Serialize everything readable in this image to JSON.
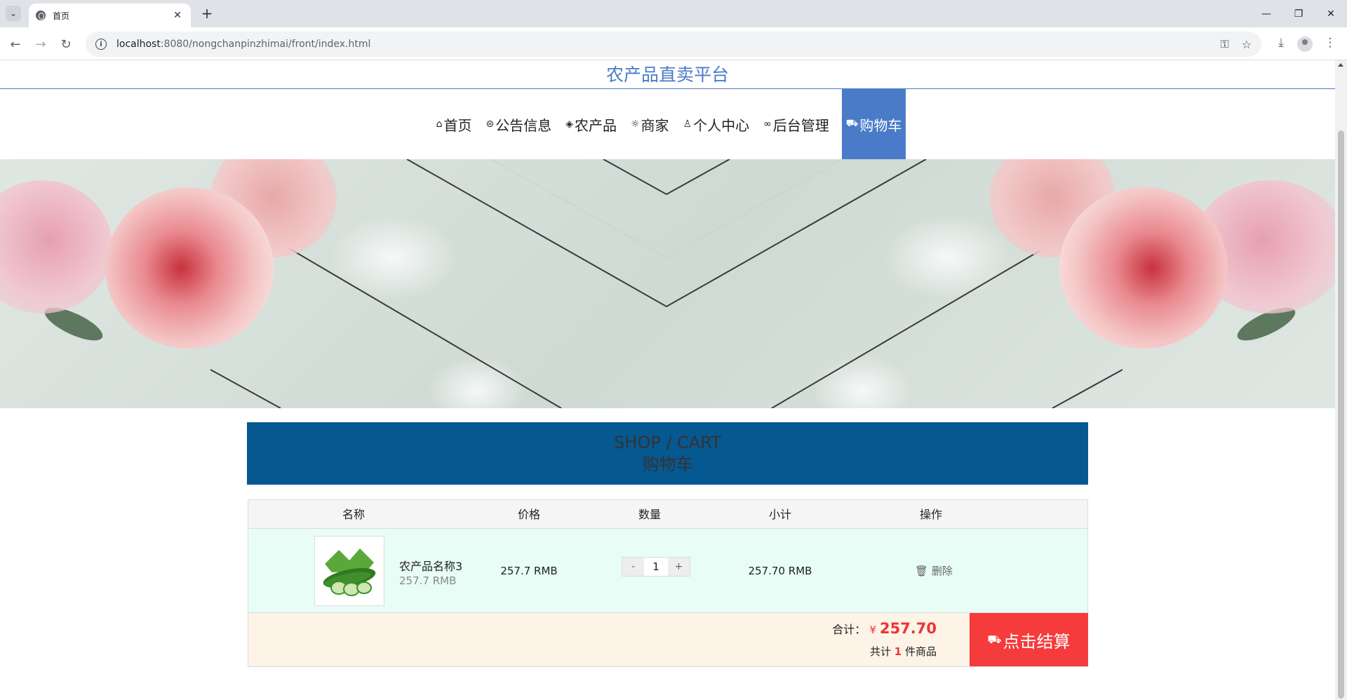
{
  "browser": {
    "tab_title": "首页",
    "url_host": "localhost",
    "url_rest": ":8080/nongchanpinzhimai/front/index.html"
  },
  "site": {
    "title": "农产品直卖平台"
  },
  "nav": [
    {
      "icon": "⌂",
      "label": "首页"
    },
    {
      "icon": "⊜",
      "label": "公告信息"
    },
    {
      "icon": "◈",
      "label": "农产品"
    },
    {
      "icon": "☼",
      "label": "商家"
    },
    {
      "icon": "♙",
      "label": "个人中心"
    },
    {
      "icon": "∞",
      "label": "后台管理"
    },
    {
      "icon": "⛟",
      "label": "购物车",
      "active": true
    }
  ],
  "cart_section": {
    "title_en": "SHOP / CART",
    "title_cn": "购物车"
  },
  "table": {
    "headers": [
      "名称",
      "价格",
      "数量",
      "小计",
      "操作"
    ],
    "rows": [
      {
        "name": "农产品名称3",
        "unit_price_sub": "257.7 RMB",
        "price": "257.7 RMB",
        "quantity": "1",
        "subtotal": "257.70 RMB",
        "action": "删除"
      }
    ],
    "qty_minus": "-",
    "qty_plus": "+"
  },
  "footer": {
    "total_label": "合计：",
    "currency": "¥",
    "total_amount": "257.70",
    "count_prefix": "共计",
    "count": "1",
    "count_suffix": "件商品",
    "checkout_label": "点击结算"
  },
  "colors": {
    "brand": "#4a7bc9",
    "cart_header": "#065891",
    "checkout": "#f53b3b"
  }
}
